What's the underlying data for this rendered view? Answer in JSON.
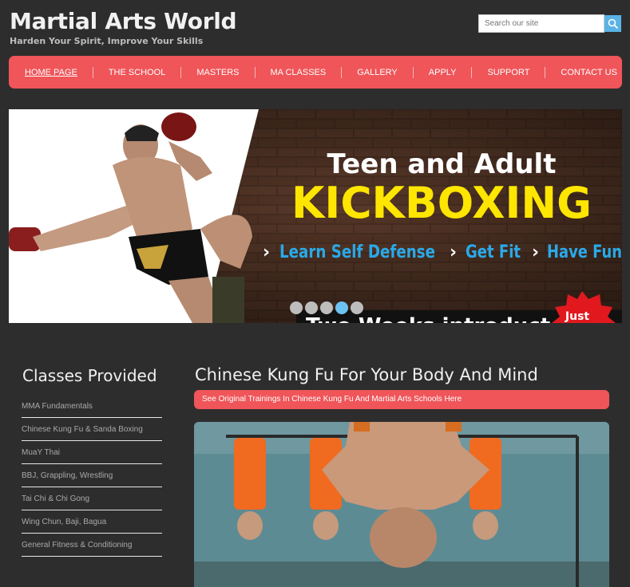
{
  "header": {
    "site_title": "Martial Arts World",
    "tagline": "Harden Your Spirit, Improve Your Skills",
    "search_placeholder": "Search our site"
  },
  "nav": {
    "items": [
      {
        "label": "HOME PAGE"
      },
      {
        "label": "THE SCHOOL"
      },
      {
        "label": "MASTERS"
      },
      {
        "label": "MA CLASSES"
      },
      {
        "label": "GALLERY"
      },
      {
        "label": "APPLY"
      },
      {
        "label": "SUPPORT"
      },
      {
        "label": "CONTACT US"
      }
    ]
  },
  "banner": {
    "heading": "Teen and Adult",
    "headline": "KICKBOXING",
    "points": [
      "Learn Self Defense",
      "Get Fit",
      "Have Fun"
    ],
    "bottom_text": "Two Weeks introductory",
    "badge_text": "Just",
    "slide_count": 5,
    "active_slide": 4
  },
  "sidebar": {
    "title": "Classes Provided",
    "items": [
      {
        "label": "MMA Fundamentals"
      },
      {
        "label": "Chinese Kung Fu & Sanda Boxing"
      },
      {
        "label": "MuaY Thai"
      },
      {
        "label": "BBJ, Grappling, Wrestling"
      },
      {
        "label": "Tai Chi & Chi Gong"
      },
      {
        "label": "Wing Chun, Baji, Bagua"
      },
      {
        "label": "General Fitness & Conditioning"
      }
    ]
  },
  "main": {
    "title": "Chinese Kung Fu For Your Body And Mind",
    "subtitle": "See Original Trainings In Chinese  Kung Fu  And Martial Arts Schools Here"
  },
  "colors": {
    "accent": "#ef5559",
    "background": "#2e2d2d",
    "headline_yellow": "#ffe600",
    "highlight_blue": "#2aa9e8"
  }
}
